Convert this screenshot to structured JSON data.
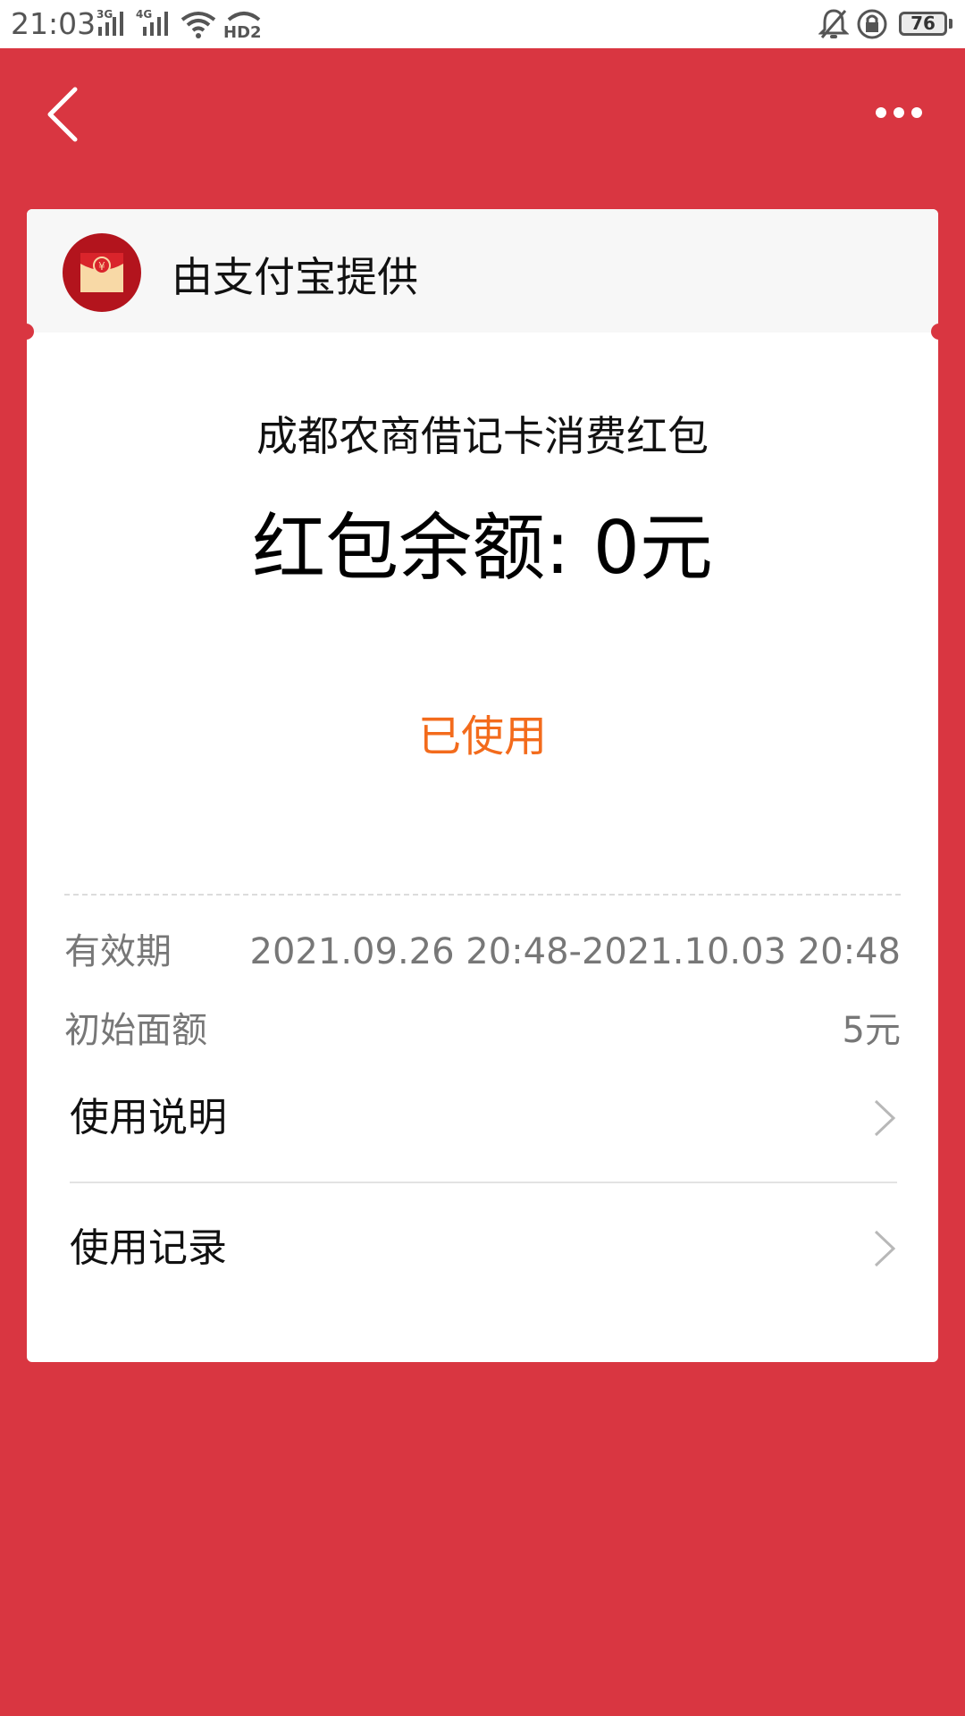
{
  "status_bar": {
    "time": "21:03",
    "network1": "3G",
    "network2": "4G",
    "hd": "HD2",
    "battery": "76"
  },
  "header": {
    "back_icon": "chevron-left-icon",
    "more_icon": "more-dots-icon"
  },
  "card": {
    "provider": "由支付宝提供",
    "title": "成都农商借记卡消费红包",
    "balance": "红包余额: 0元",
    "status": "已使用",
    "validity_label": "有效期",
    "validity_value": "2021.09.26 20:48-2021.10.03 20:48",
    "initial_label": "初始面额",
    "initial_value": "5元",
    "links": [
      {
        "label": "使用说明"
      },
      {
        "label": "使用记录"
      }
    ]
  },
  "colors": {
    "background": "#d93641",
    "status_used": "#f36b1c",
    "logo_red": "#b3141d"
  }
}
